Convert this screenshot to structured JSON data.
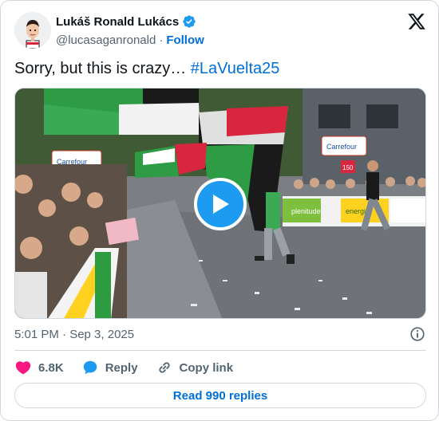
{
  "author": {
    "display_name": "Lukáš Ronald Lukács",
    "handle": "@lucasaganronald",
    "separator": "·",
    "follow_label": "Follow",
    "verified": true
  },
  "post": {
    "text": "Sorry, but this is crazy… ",
    "hashtag": "#LaVuelta25",
    "timestamp": "5:01 PM · Sep 3, 2025"
  },
  "media": {
    "type": "video",
    "scene_signs": [
      "Carrefour",
      "Carrefour",
      "150",
      "plenitude",
      "energia"
    ]
  },
  "actions": {
    "like_count": "6.8K",
    "reply_label": "Reply",
    "copy_link_label": "Copy link"
  },
  "replies_button": "Read 990 replies",
  "colors": {
    "accent_blue": "#1d9bf0",
    "link_blue": "#006fd6",
    "like_pink": "#f91880",
    "secondary_text": "#536471",
    "border": "#cfd9de"
  }
}
